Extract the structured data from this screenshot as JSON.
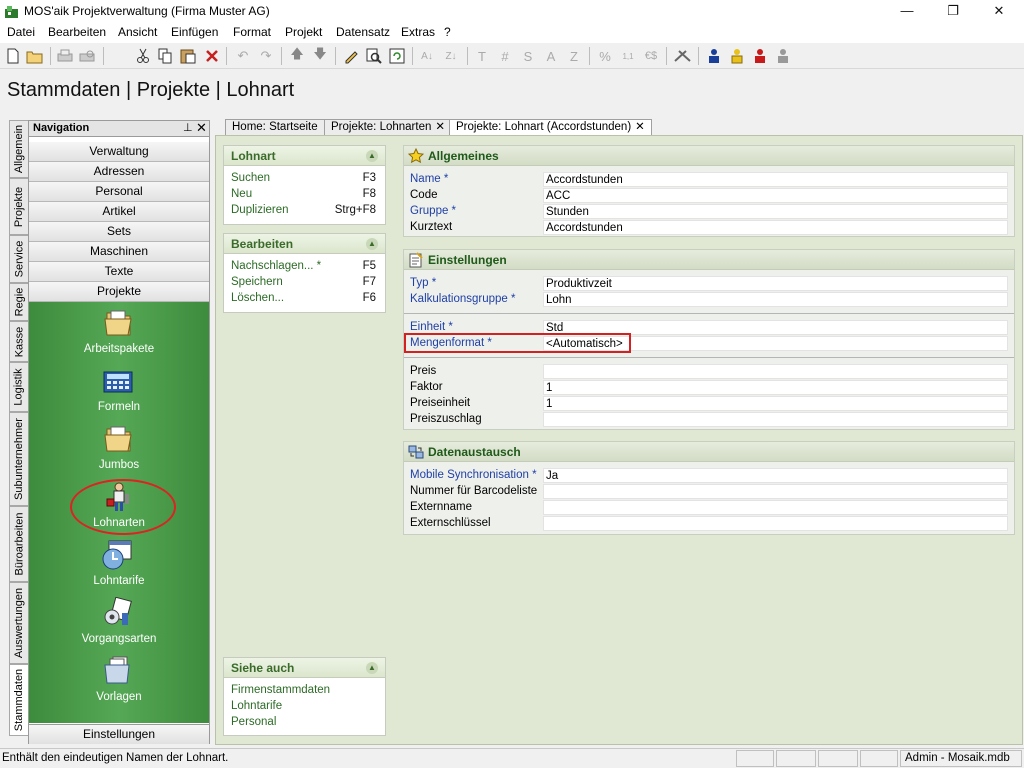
{
  "window": {
    "title": "MOS'aik Projektverwaltung (Firma Muster AG)",
    "minimize": "—",
    "restore": "❐",
    "close": "✕"
  },
  "menu": [
    "Datei",
    "Bearbeiten",
    "Ansicht",
    "Einfügen",
    "Format",
    "Projekt",
    "Datensatz",
    "Extras",
    "?"
  ],
  "toolbar": {
    "icons": [
      "new-icon",
      "open-icon",
      "print-icon",
      "print-preview-icon",
      "cut-icon",
      "copy-icon",
      "paste-icon",
      "delete-icon",
      "undo-icon",
      "redo-icon",
      "arrow-up-icon",
      "arrow-down-icon",
      "edit-icon",
      "lookup-icon",
      "refresh-icon",
      "sort-asc-icon",
      "sort-desc-icon",
      "text-format-icon",
      "number-format-icon",
      "s-format-icon",
      "a-format-icon",
      "z-format-icon",
      "percent-icon",
      "decimal-icon",
      "currency-icon",
      "tools-icon",
      "user-blue-icon",
      "user-yellow-icon",
      "user-red-icon",
      "user-gray-icon"
    ],
    "text": {
      "t": "T",
      "hash": "#",
      "s": "S",
      "a": "A",
      "z": "Z",
      "pct": "%",
      "dec": "1,1",
      "cur": "€$"
    }
  },
  "page_heading": "Stammdaten | Projekte | Lohnart",
  "side_tabs": [
    "Allgemein",
    "Projekte",
    "Service",
    "Regie",
    "Kasse",
    "Logistik",
    "Subunternehmer",
    "Büroarbeiten",
    "Auswertungen",
    "Stammdaten"
  ],
  "navigation": {
    "title": "Navigation",
    "pin": "⊥",
    "close": "✕",
    "buttons": [
      "Verwaltung",
      "Adressen",
      "Personal",
      "Artikel",
      "Sets",
      "Maschinen",
      "Texte",
      "Projekte"
    ],
    "items": [
      {
        "label": "Arbeitspakete",
        "icon": "folder-icon"
      },
      {
        "label": "Formeln",
        "icon": "calculator-icon"
      },
      {
        "label": "Jumbos",
        "icon": "folder-icon"
      },
      {
        "label": "Lohnarten",
        "icon": "worker-icon"
      },
      {
        "label": "Lohntarife",
        "icon": "clock-calendar-icon"
      },
      {
        "label": "Vorgangsarten",
        "icon": "gear-doc-icon"
      },
      {
        "label": "Vorlagen",
        "icon": "folder-docs-icon"
      }
    ],
    "footer": "Einstellungen"
  },
  "doc_tabs": [
    {
      "label": "Home: Startseite",
      "closable": false
    },
    {
      "label": "Projekte: Lohnarten",
      "closable": true
    },
    {
      "label": "Projekte: Lohnart (Accordstunden)",
      "closable": true
    }
  ],
  "task_panels": {
    "lohnart": {
      "title": "Lohnart",
      "items": [
        {
          "label": "Suchen",
          "key": "F3"
        },
        {
          "label": "Neu",
          "key": "F8"
        },
        {
          "label": "Duplizieren",
          "key": "Strg+F8"
        }
      ]
    },
    "bearbeiten": {
      "title": "Bearbeiten",
      "items": [
        {
          "label": "Nachschlagen... *",
          "key": "F5"
        },
        {
          "label": "Speichern",
          "key": "F7"
        },
        {
          "label": "Löschen...",
          "key": "F6"
        }
      ]
    },
    "siehe_auch": {
      "title": "Siehe auch",
      "items": [
        {
          "label": "Firmenstammdaten"
        },
        {
          "label": "Lohntarife"
        },
        {
          "label": "Personal"
        }
      ]
    }
  },
  "groups": {
    "allgemeines": {
      "title": "Allgemeines",
      "fields": [
        {
          "label": "Name *",
          "value": "Accordstunden",
          "required": true
        },
        {
          "label": "Code",
          "value": "ACC",
          "required": false
        },
        {
          "label": "Gruppe *",
          "value": "Stunden",
          "required": true
        },
        {
          "label": "Kurztext",
          "value": "Accordstunden",
          "required": false
        }
      ]
    },
    "einstellungen": {
      "title": "Einstellungen",
      "fields": [
        {
          "label": "Typ *",
          "value": "Produktivzeit",
          "required": true
        },
        {
          "label": "Kalkulationsgruppe *",
          "value": "Lohn",
          "required": true
        },
        {
          "label": "Einheit *",
          "value": "Std",
          "required": true
        },
        {
          "label": "Mengenformat *",
          "value": "<Automatisch>",
          "required": true
        },
        {
          "label": "Preis",
          "value": "",
          "required": false
        },
        {
          "label": "Faktor",
          "value": "1",
          "required": false
        },
        {
          "label": "Preiseinheit",
          "value": "1",
          "required": false
        },
        {
          "label": "Preiszuschlag",
          "value": "",
          "required": false
        }
      ]
    },
    "datenaustausch": {
      "title": "Datenaustausch",
      "fields": [
        {
          "label": "Mobile Synchronisation *",
          "value": "Ja",
          "required": true
        },
        {
          "label": "Nummer für Barcodeliste",
          "value": "",
          "required": false
        },
        {
          "label": "Externname",
          "value": "",
          "required": false
        },
        {
          "label": "Externschlüssel",
          "value": "",
          "required": false
        }
      ]
    }
  },
  "status": {
    "message": "Enthält den eindeutigen Namen der Lohnart.",
    "user": "Admin - Mosaik.mdb"
  },
  "colors": {
    "nav_green": "#4a9c4a",
    "required_label": "#1f3fa8",
    "highlight_red": "#d32020",
    "group_title": "#1f5a1a"
  }
}
